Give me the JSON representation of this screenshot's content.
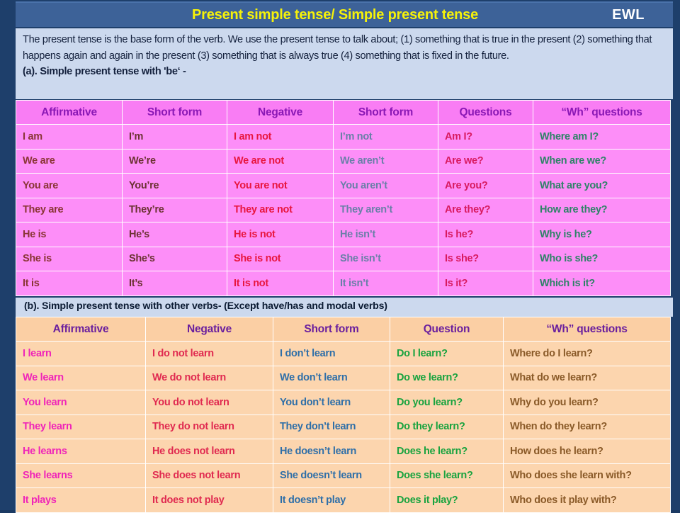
{
  "header": {
    "title": "Present simple tense/ Simple present tense",
    "logo": "EWL",
    "title_color": "#f5f10a",
    "bar_color": "#3d6298"
  },
  "intro": {
    "paragraph": "The present tense is the base form of the verb. We use the present tense to talk about; (1) something that is true in the present (2) something that happens again and again in the present (3) something that is always true (4) something that is fixed in the future.",
    "section_a_label": "(a). Simple present tense with 'be‘ -"
  },
  "section_b": {
    "label": "(b). Simple present tense with other verbs-  (Except have/has and modal verbs)"
  },
  "table_be": {
    "headers": [
      "Affirmative",
      "Short form",
      "Negative",
      "Short form",
      "Questions",
      "“Wh” questions"
    ],
    "rows": [
      [
        "I am",
        "I’m",
        "I am not",
        "I’m not",
        "Am I?",
        "Where am I?"
      ],
      [
        "We are",
        "We’re",
        "We are not",
        "We aren’t",
        "Are we?",
        "When are we?"
      ],
      [
        "You are",
        "You’re",
        "You are not",
        "You aren’t",
        "Are you?",
        "What are you?"
      ],
      [
        "They are",
        "They’re",
        "They are not",
        "They aren’t",
        "Are they?",
        "How are they?"
      ],
      [
        "He is",
        "He’s",
        "He is not",
        "He isn’t",
        "Is he?",
        "Why is he?"
      ],
      [
        "She is",
        "She’s",
        "She is not",
        "She isn’t",
        "Is she?",
        "Who is she?"
      ],
      [
        "It is",
        "It’s",
        "It is not",
        "It isn’t",
        "Is it?",
        "Which is it?"
      ]
    ],
    "header_bg": "#f97df4",
    "header_color": "#8a18b5",
    "body_bg": "#fd8ef8"
  },
  "table_verbs": {
    "headers": [
      "Affirmative",
      "Negative",
      "Short form",
      "Question",
      "“Wh” questions"
    ],
    "rows": [
      [
        "I learn",
        "I do not learn",
        "I don’t learn",
        "Do I learn?",
        "Where do I learn?"
      ],
      [
        "We learn",
        "We do not learn",
        "We don’t learn",
        "Do we learn?",
        "What do we learn?"
      ],
      [
        "You learn",
        "You do not learn",
        "You don’t learn",
        "Do you learn?",
        "Why do you learn?"
      ],
      [
        "They learn",
        "They do not learn",
        "They don’t learn",
        "Do they learn?",
        "When do they learn?"
      ],
      [
        "He learns",
        "He does not learn",
        "He doesn’t learn",
        "Does he learn?",
        "How does he learn?"
      ],
      [
        "She learns",
        "She does not learn",
        "She doesn’t learn",
        "Does she learn?",
        "Who does she learn with?"
      ],
      [
        "It plays",
        "It does not play",
        "It doesn’t play",
        "Does it play?",
        "Who does it play with?"
      ]
    ],
    "header_bg": "#fbcfa4",
    "header_color": "#6a1f9e",
    "body_bg": "#fcd5ae"
  }
}
